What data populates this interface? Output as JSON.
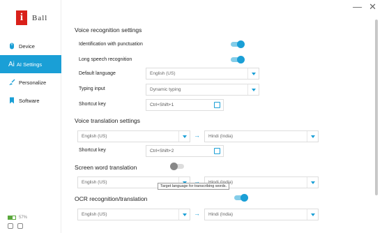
{
  "window": {
    "minimize": "—",
    "close": "✕"
  },
  "brand": {
    "logo_letter": "i",
    "name": "Ball"
  },
  "sidebar": {
    "items": [
      {
        "label": "Device",
        "icon": "mouse-icon"
      },
      {
        "label": "AI Settings",
        "icon": "ai-icon",
        "active": true
      },
      {
        "label": "Personalize",
        "icon": "brush-icon"
      },
      {
        "label": "Software",
        "icon": "bookmark-icon"
      }
    ],
    "ai_prefix": "Ai",
    "battery": "57%",
    "battery_level": 0.57
  },
  "voice": {
    "title": "Voice recognition settings",
    "punctuation_label": "Identification with punctuation",
    "punctuation_on": true,
    "long_speech_label": "Long speech recognition",
    "long_speech_on": true,
    "default_language_label": "Default language",
    "default_language_value": "English (US)",
    "typing_input_label": "Typing input",
    "typing_input_value": "Dynamic typing",
    "shortcut_label": "Shortcut key",
    "shortcut_value": "Ctrl+Shift+1"
  },
  "voice_translation": {
    "title": "Voice translation settings",
    "source": "English (US)",
    "target": "Hindi (India)",
    "shortcut_label": "Shortcut key",
    "shortcut_value": "Ctrl+Shift+2"
  },
  "screen_word": {
    "title": "Screen word translation",
    "enabled": false,
    "source": "English (US)",
    "target": "Hindi (India)",
    "tooltip": "Target language for transcribing words."
  },
  "ocr": {
    "title": "OCR recognition/translation",
    "enabled": true,
    "source": "English (US)",
    "target": "Hindi (India)"
  },
  "arrow": "→",
  "colors": {
    "accent": "#1a9fd6",
    "brand": "#d9201a"
  }
}
